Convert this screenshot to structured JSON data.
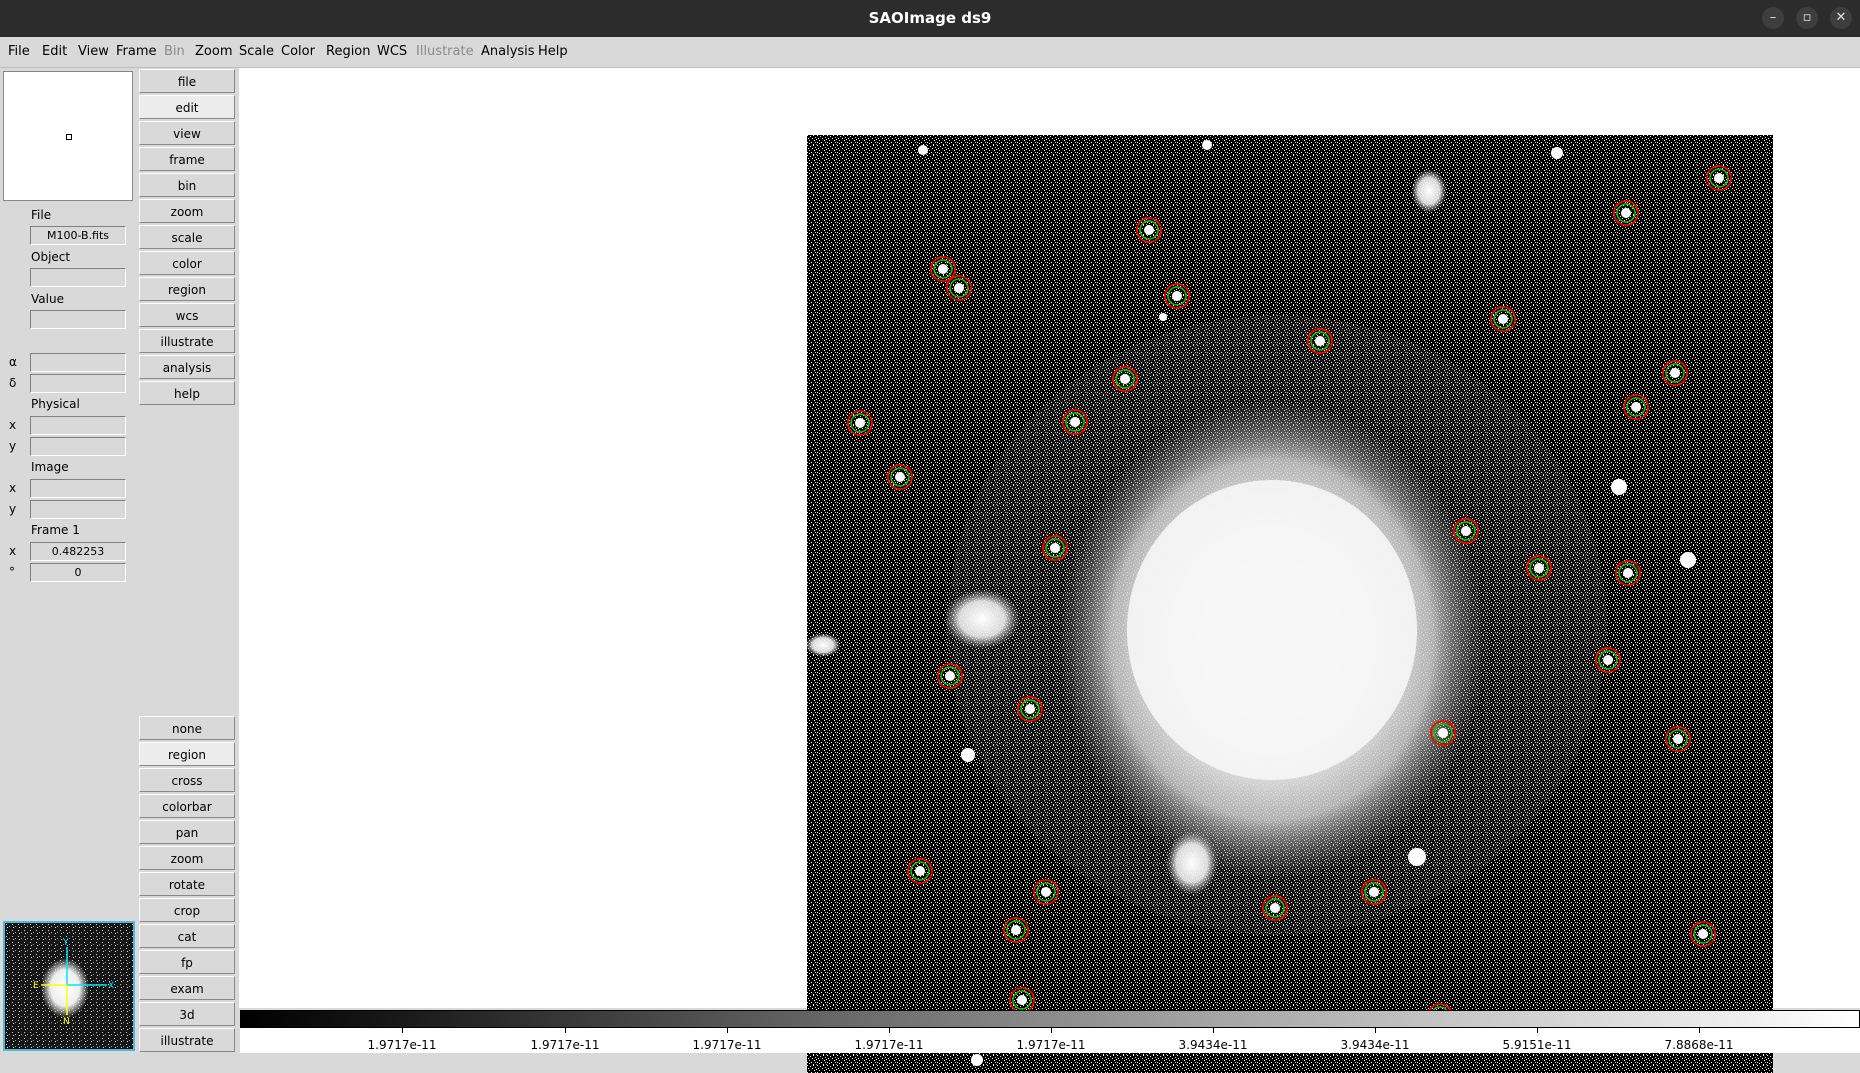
{
  "window": {
    "title": "SAOImage ds9",
    "controls": [
      "minimize-icon",
      "maximize-icon",
      "close-icon"
    ]
  },
  "menu": [
    "File",
    "Edit",
    "View",
    "Frame",
    "Bin",
    "Zoom",
    "Scale",
    "Color",
    "Region",
    "WCS",
    "Illustrate",
    "Analysis",
    "Help"
  ],
  "menu_disabled": [
    "Bin",
    "Illustrate"
  ],
  "info_panel": {
    "file_label": "File",
    "file_value": "M100-B.fits",
    "object_label": "Object",
    "object_value": "",
    "value_label": "Value",
    "value_value": "",
    "alpha_symbol": "α",
    "delta_symbol": "δ",
    "alpha_value": "",
    "delta_value": "",
    "physical_label": "Physical",
    "physical_x_symbol": "x",
    "physical_y_symbol": "y",
    "physical_x_value": "",
    "physical_y_value": "",
    "image_label": "Image",
    "image_x_symbol": "x",
    "image_y_symbol": "y",
    "image_x_value": "",
    "image_y_value": "",
    "frame_label": "Frame 1",
    "frame_zoom_symbol": "x",
    "frame_zoom_value": "0.482253",
    "frame_angle_symbol": "°",
    "frame_angle_value": "0"
  },
  "buttons_top": [
    "file",
    "edit",
    "view",
    "frame",
    "bin",
    "zoom",
    "scale",
    "color",
    "region",
    "wcs",
    "illustrate",
    "analysis",
    "help"
  ],
  "buttons_top_active": "edit",
  "buttons_bottom": [
    "none",
    "region",
    "cross",
    "colorbar",
    "pan",
    "zoom",
    "rotate",
    "crop",
    "cat",
    "fp",
    "exam",
    "3d",
    "illustrate"
  ],
  "buttons_bottom_active": "region",
  "colorbar_ticks": [
    "1.9717e-11",
    "1.9717e-11",
    "1.9717e-11",
    "1.9717e-11",
    "1.9717e-11",
    "3.9434e-11",
    "3.9434e-11",
    "5.9151e-11",
    "7.8868e-11"
  ],
  "panner_compass": {
    "north": "N",
    "east": "E",
    "x_label": "X",
    "y_label": "Y"
  },
  "colors": {
    "region_outer": "#ff0000",
    "region_inner": "#00cc00",
    "panner_border": "#4fb9d6",
    "compass_wcs": "#ffff00",
    "compass_image": "#00e5ff"
  }
}
